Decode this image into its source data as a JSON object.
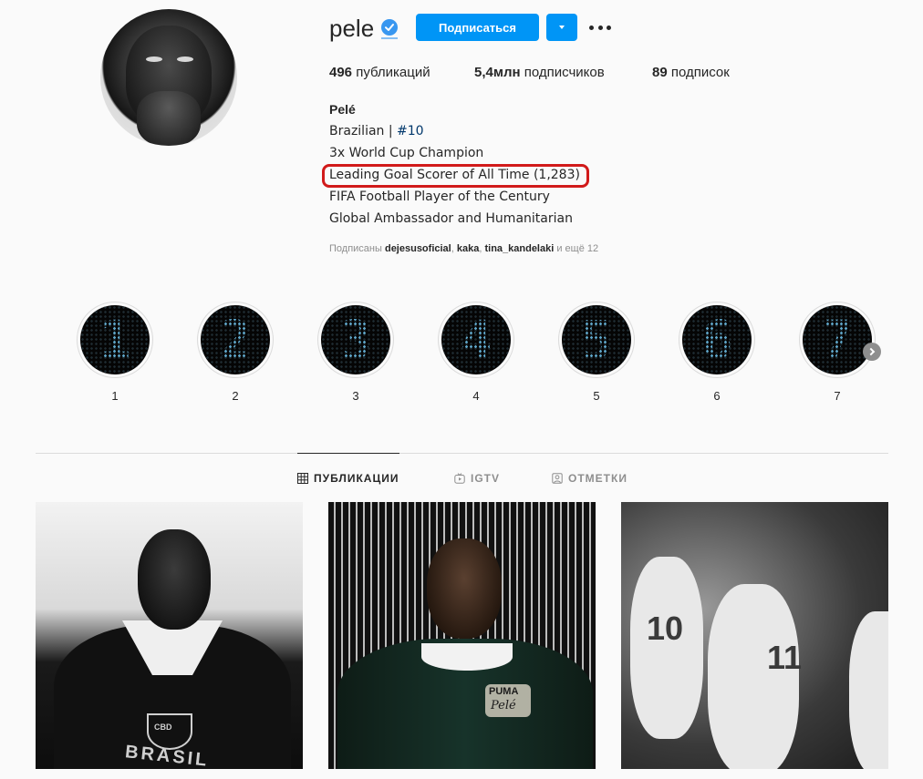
{
  "profile": {
    "username": "pele",
    "follow_label": "Подписаться",
    "stats": {
      "posts_value": "496",
      "posts_label": "публикаций",
      "followers_value": "5,4млн",
      "followers_label": "подписчиков",
      "following_value": "89",
      "following_label": "подписок"
    },
    "bio": {
      "name": "Pelé",
      "line1_text": "Brazilian | ",
      "line1_tag": "#10",
      "line2": "3x World Cup Champion",
      "line3": "Leading Goal Scorer of All Time (1,283)",
      "line4": "FIFA Football Player of the Century",
      "line5": "Global Ambassador and Humanitarian"
    },
    "followed_by": {
      "prefix": "Подписаны",
      "user1": "dejesusoficial",
      "user2": "kaka",
      "user3": "tina_kandelaki",
      "suffix": "и ещё 12"
    },
    "icons": {
      "verified": "verified-badge-icon",
      "more": "more-horizontal-icon",
      "dropdown": "chevron-down-icon"
    },
    "colors": {
      "accent": "#0095f6",
      "verified": "#3897f0",
      "highlight_annotation": "#d11a1a"
    }
  },
  "highlights": [
    {
      "label": "1",
      "digit": "1"
    },
    {
      "label": "2",
      "digit": "2"
    },
    {
      "label": "3",
      "digit": "3"
    },
    {
      "label": "4",
      "digit": "4"
    },
    {
      "label": "5",
      "digit": "5"
    },
    {
      "label": "6",
      "digit": "6"
    },
    {
      "label": "7",
      "digit": "7"
    }
  ],
  "tabs": [
    {
      "label": "ПУБЛИКАЦИИ",
      "icon": "grid-icon",
      "active": true
    },
    {
      "label": "IGTV",
      "icon": "igtv-icon",
      "active": false
    },
    {
      "label": "ОТМЕТКИ",
      "icon": "tagged-icon",
      "active": false
    }
  ],
  "posts": [
    {
      "text": "BRASIL",
      "badge": "CBD"
    },
    {
      "brand": "PUMA",
      "script": "Pelé"
    },
    {
      "numbers": [
        "10",
        "11"
      ]
    }
  ]
}
